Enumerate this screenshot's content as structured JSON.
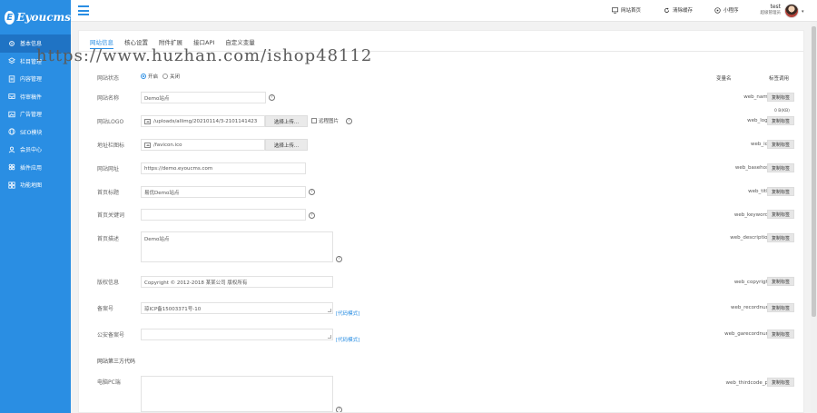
{
  "app": {
    "logo_text": "Eyoucms",
    "logo_mark": "E"
  },
  "sidebar": {
    "items": [
      {
        "label": "基本信息",
        "icon": "gear-icon",
        "active": true
      },
      {
        "label": "栏目管理",
        "icon": "layers-icon",
        "active": false
      },
      {
        "label": "内容管理",
        "icon": "document-icon",
        "active": false
      },
      {
        "label": "待审稿件",
        "icon": "inbox-icon",
        "active": false
      },
      {
        "label": "广告管理",
        "icon": "image-icon",
        "active": false
      },
      {
        "label": "SEO模块",
        "icon": "globe-icon",
        "active": false
      },
      {
        "label": "会员中心",
        "icon": "user-icon",
        "active": false
      },
      {
        "label": "插件应用",
        "icon": "plugin-icon",
        "active": false
      },
      {
        "label": "功能地图",
        "icon": "grid-icon",
        "active": false
      }
    ]
  },
  "topbar": {
    "home_label": "网站首页",
    "clear_cache_label": "清除缓存",
    "mini_program_label": "小程序",
    "user_name": "test",
    "user_role": "超级管理员",
    "caret": "▾"
  },
  "tabs": [
    {
      "label": "网站信息",
      "active": true
    },
    {
      "label": "核心设置",
      "active": false
    },
    {
      "label": "附件扩展",
      "active": false
    },
    {
      "label": "接口API",
      "active": false
    },
    {
      "label": "自定义变量",
      "active": false
    }
  ],
  "watermark": "https://www.huzhan.com/ishop48112",
  "columns": {
    "var_name": "变量名",
    "tag_call": "标签调用"
  },
  "copy_label": "复制标签",
  "help_glyph": "?",
  "upload_label": "选择上传...",
  "rows": {
    "status": {
      "label": "网站状态",
      "on_label": "开启",
      "off_label": "关闭"
    },
    "name": {
      "label": "网站名称",
      "value": "Demo站点",
      "var": "web_name"
    },
    "logo": {
      "label": "网站LOGO",
      "value": "/uploads/allimg/20210114/3-2101141423",
      "var": "web_logo",
      "remote_label": "远程图片",
      "size_note": "0 B(KB)"
    },
    "ico": {
      "label": "地址栏图标",
      "value": "/favicon.ico",
      "var": "web_ico"
    },
    "basehost": {
      "label": "网站网址",
      "value": "https://demo.eyoucms.com",
      "var": "web_basehost"
    },
    "title": {
      "label": "首页标题",
      "value": "易优Demo站点",
      "var": "web_title"
    },
    "keywords": {
      "label": "首页关键词",
      "value": "",
      "var": "web_keywords"
    },
    "description": {
      "label": "首页描述",
      "value": "Demo站点",
      "var": "web_description"
    },
    "copyright": {
      "label": "版权信息",
      "value": "Copyright © 2012-2018 某某公司 版权所有",
      "var": "web_copyright"
    },
    "recordnum": {
      "label": "备案号",
      "value": "琼ICP备15003371号-10",
      "var": "web_recordnum",
      "code_mode": "[代码模式]"
    },
    "garecordnum": {
      "label": "公安备案号",
      "value": "",
      "var": "web_garecordnum",
      "code_mode": "[代码模式]"
    },
    "third_section": {
      "label": "网站第三方代码"
    },
    "thirdcode_pc": {
      "label": "电脑PC端",
      "value": "",
      "var": "web_thirdcode_pc"
    }
  },
  "colors": {
    "brand": "#2a8ee3",
    "sidebar_active": "#1f73c4"
  }
}
